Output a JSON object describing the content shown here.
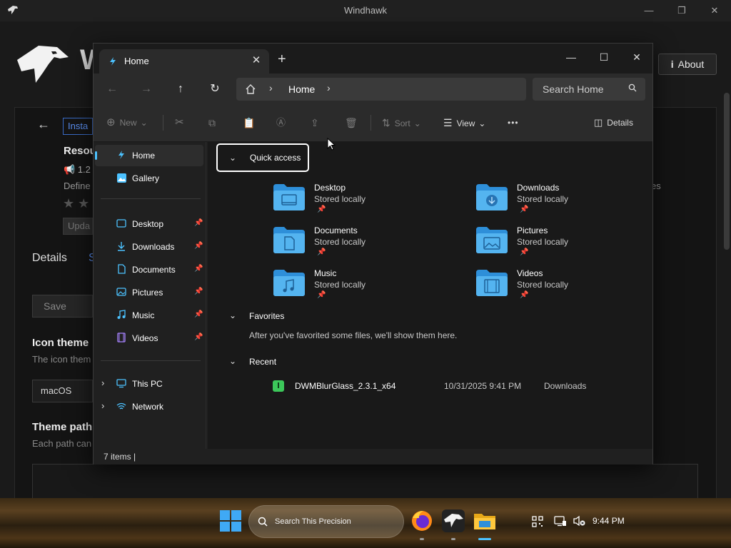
{
  "windhawk": {
    "title": "Windhawk",
    "brand_partial": "W",
    "about_label": "About",
    "install_partial": "Insta",
    "mod_name_partial": "Resou",
    "version_partial": "1.2",
    "desc_partial": "Define",
    "desc_right_partial": "es",
    "update_partial": "Upda",
    "tab_details": "Details",
    "tab_partial": "S",
    "save_partial": "Save settin",
    "icon_theme_title": "Icon theme",
    "icon_theme_desc": "The icon them",
    "select_value": "macOS Blue",
    "theme_path_title": "Theme path",
    "theme_path_desc": "Each path can",
    "ctrl_minimize": "—",
    "ctrl_restore": "❐",
    "ctrl_close": "✕"
  },
  "explorer": {
    "tab_title": "Home",
    "tab_close": "✕",
    "new_tab": "+",
    "ctrl_minimize": "—",
    "ctrl_maximize": "☐",
    "ctrl_close": "✕",
    "breadcrumb": "Home",
    "search_placeholder": "Search Home",
    "commands": {
      "new": "New",
      "sort": "Sort",
      "view": "View",
      "more": "•••",
      "details": "Details"
    },
    "nav": [
      {
        "label": "Home",
        "selected": true
      },
      {
        "label": "Gallery"
      },
      {
        "label": "Desktop",
        "pinned": true
      },
      {
        "label": "Downloads",
        "pinned": true
      },
      {
        "label": "Documents",
        "pinned": true
      },
      {
        "label": "Pictures",
        "pinned": true
      },
      {
        "label": "Music",
        "pinned": true
      },
      {
        "label": "Videos",
        "pinned": true
      },
      {
        "label": "This PC"
      },
      {
        "label": "Network"
      }
    ],
    "quick_access": {
      "title": "Quick access",
      "items": [
        {
          "name": "Desktop",
          "sub": "Stored locally"
        },
        {
          "name": "Downloads",
          "sub": "Stored locally"
        },
        {
          "name": "Documents",
          "sub": "Stored locally"
        },
        {
          "name": "Pictures",
          "sub": "Stored locally"
        },
        {
          "name": "Music",
          "sub": "Stored locally"
        },
        {
          "name": "Videos",
          "sub": "Stored locally"
        }
      ]
    },
    "favorites": {
      "title": "Favorites",
      "message": "After you've favorited some files, we'll show them here."
    },
    "recent": {
      "title": "Recent",
      "items": [
        {
          "name": "DWMBlurGlass_2.3.1_x64",
          "date": "10/31/2025 9:41 PM",
          "location": "Downloads"
        }
      ]
    },
    "status": "7 items  |"
  },
  "taskbar": {
    "search_placeholder": "Search This Precision",
    "clock": "9:44 PM"
  },
  "colors": {
    "accent": "#4cc2ff",
    "folder": "#3aa0e6",
    "folder_light": "#6cc6ff"
  }
}
